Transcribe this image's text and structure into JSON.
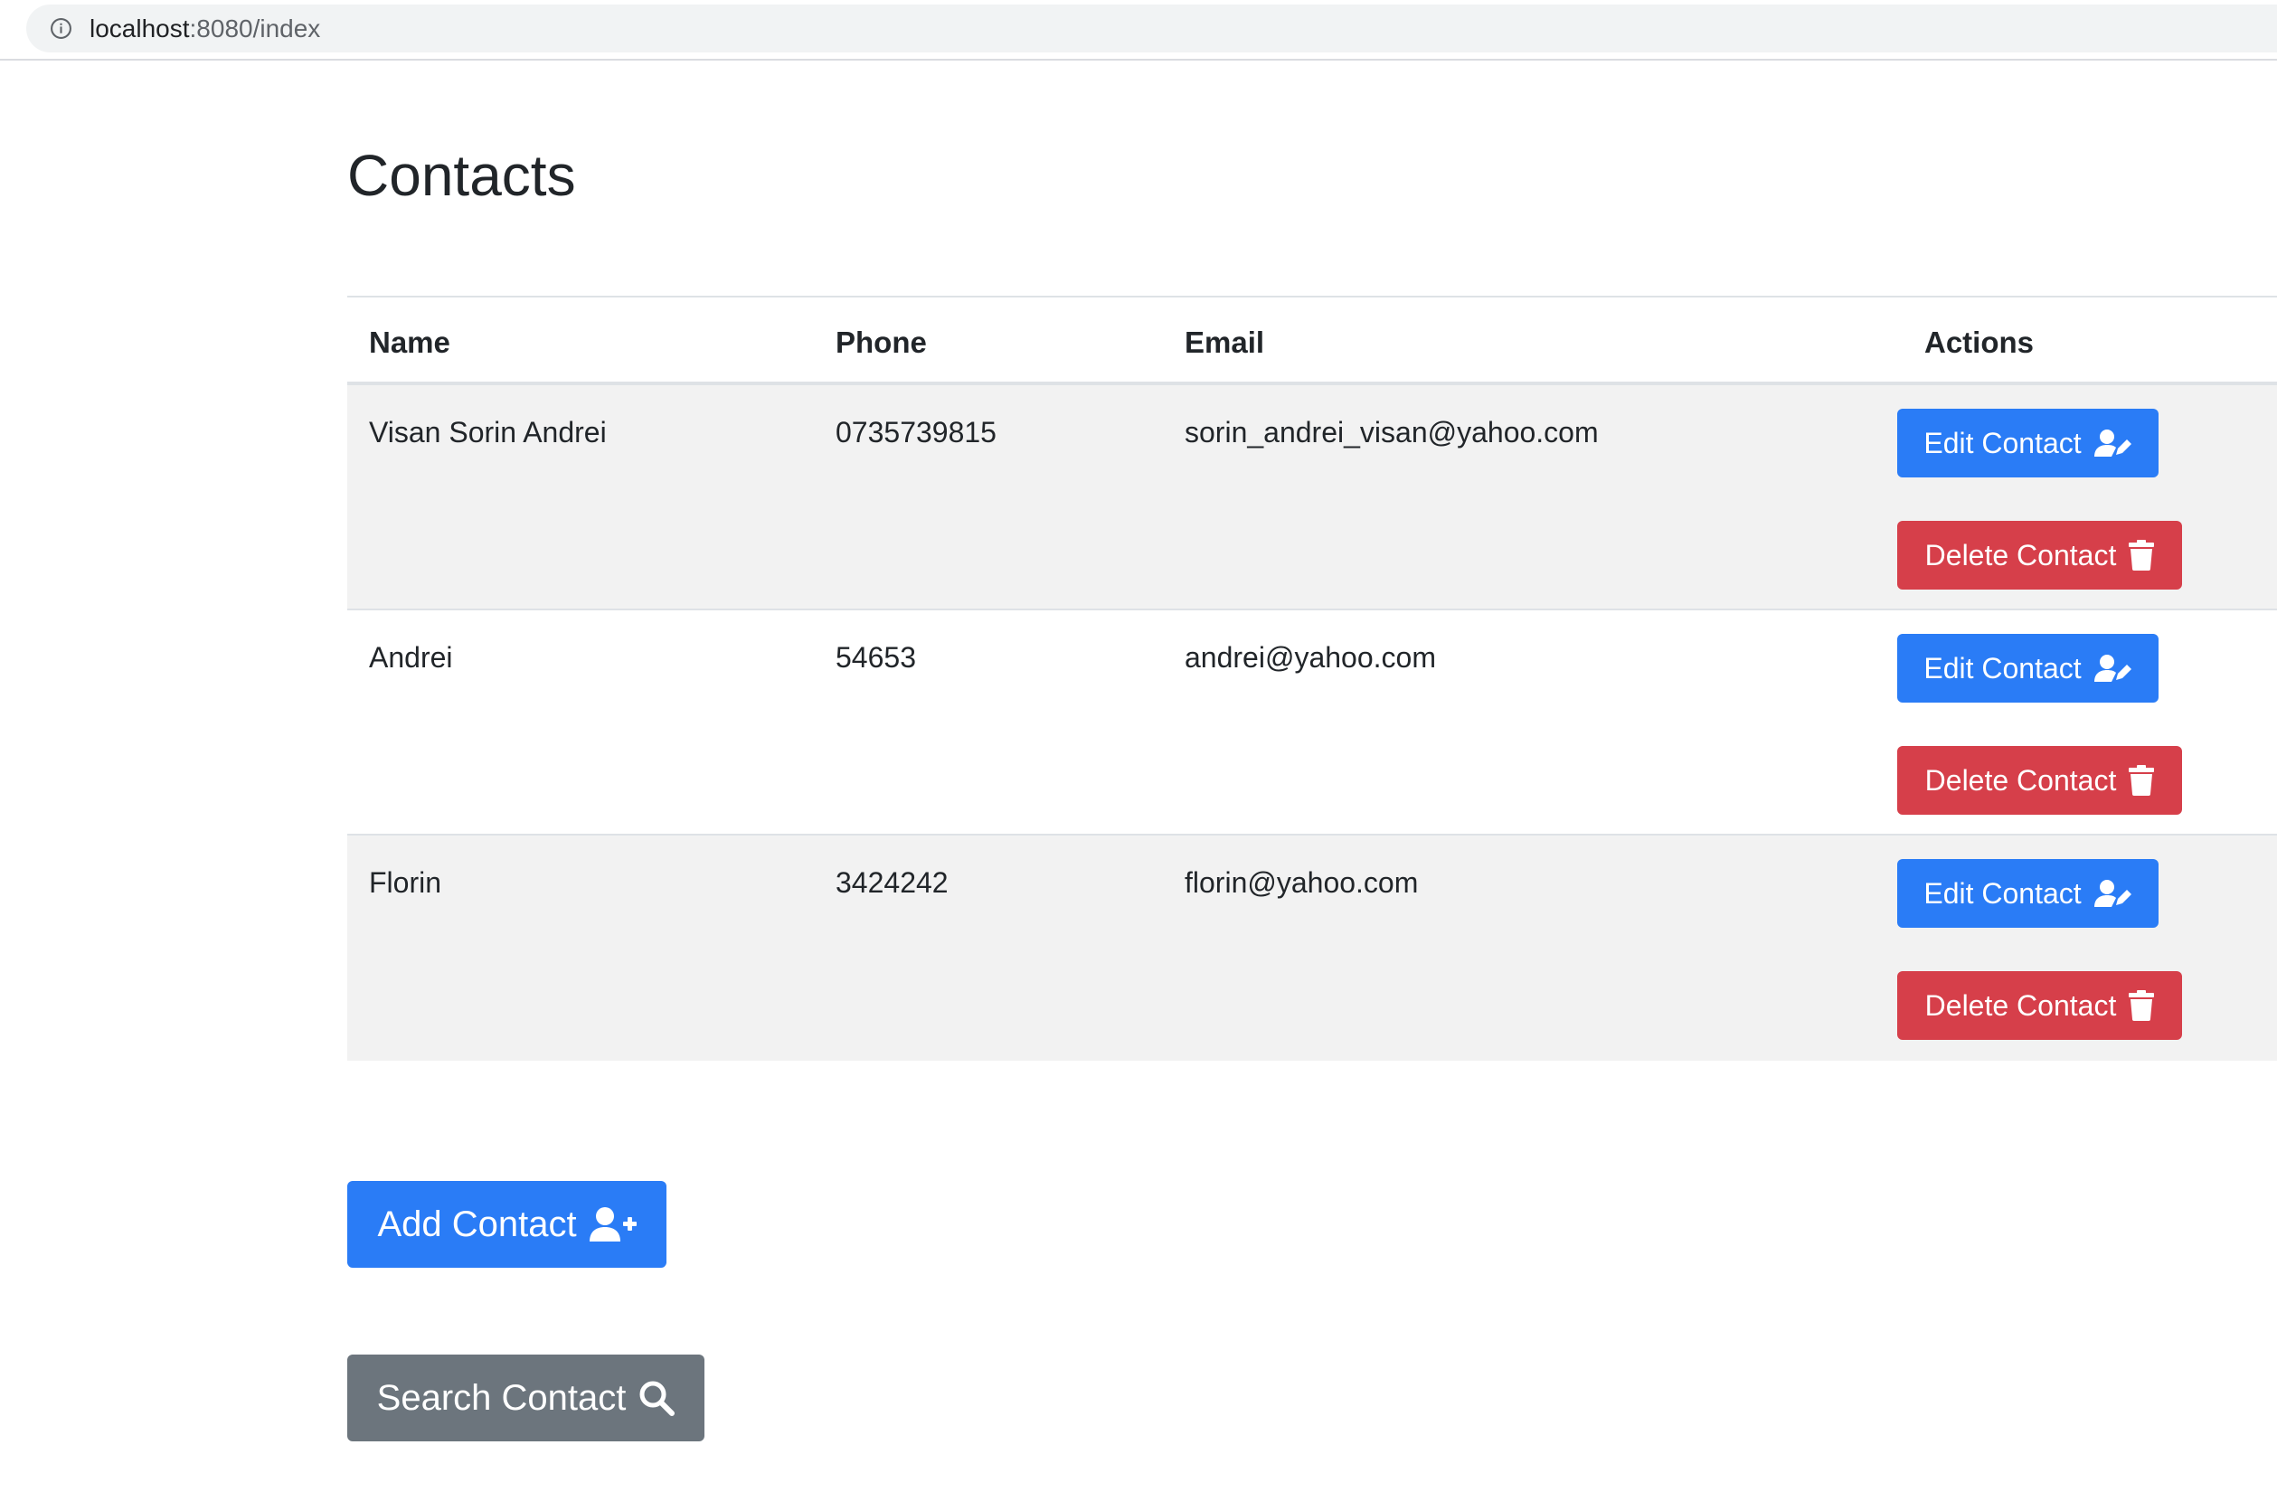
{
  "browser": {
    "url_host": "localhost",
    "url_rest": ":8080/index"
  },
  "page": {
    "title": "Contacts"
  },
  "table": {
    "headers": {
      "name": "Name",
      "phone": "Phone",
      "email": "Email",
      "actions": "Actions"
    },
    "rows": [
      {
        "name": "Visan Sorin Andrei",
        "phone": "0735739815",
        "email": "sorin_andrei_visan@yahoo.com",
        "edit_label": "Edit Contact",
        "delete_label": "Delete Contact"
      },
      {
        "name": "Andrei",
        "phone": "54653",
        "email": "andrei@yahoo.com",
        "edit_label": "Edit Contact",
        "delete_label": "Delete Contact"
      },
      {
        "name": "Florin",
        "phone": "3424242",
        "email": "florin@yahoo.com",
        "edit_label": "Edit Contact",
        "delete_label": "Delete Contact"
      }
    ]
  },
  "actions": {
    "add_label": "Add Contact",
    "search_label": "Search Contact"
  },
  "icons": {
    "info": "info-circle-icon",
    "edit": "user-edit-icon",
    "delete": "trash-icon",
    "add": "user-plus-icon",
    "search": "search-icon"
  },
  "colors": {
    "primary": "#2a7cf6",
    "danger": "#d63f4a",
    "secondary": "#6c757d",
    "stripe": "#f2f2f2"
  }
}
